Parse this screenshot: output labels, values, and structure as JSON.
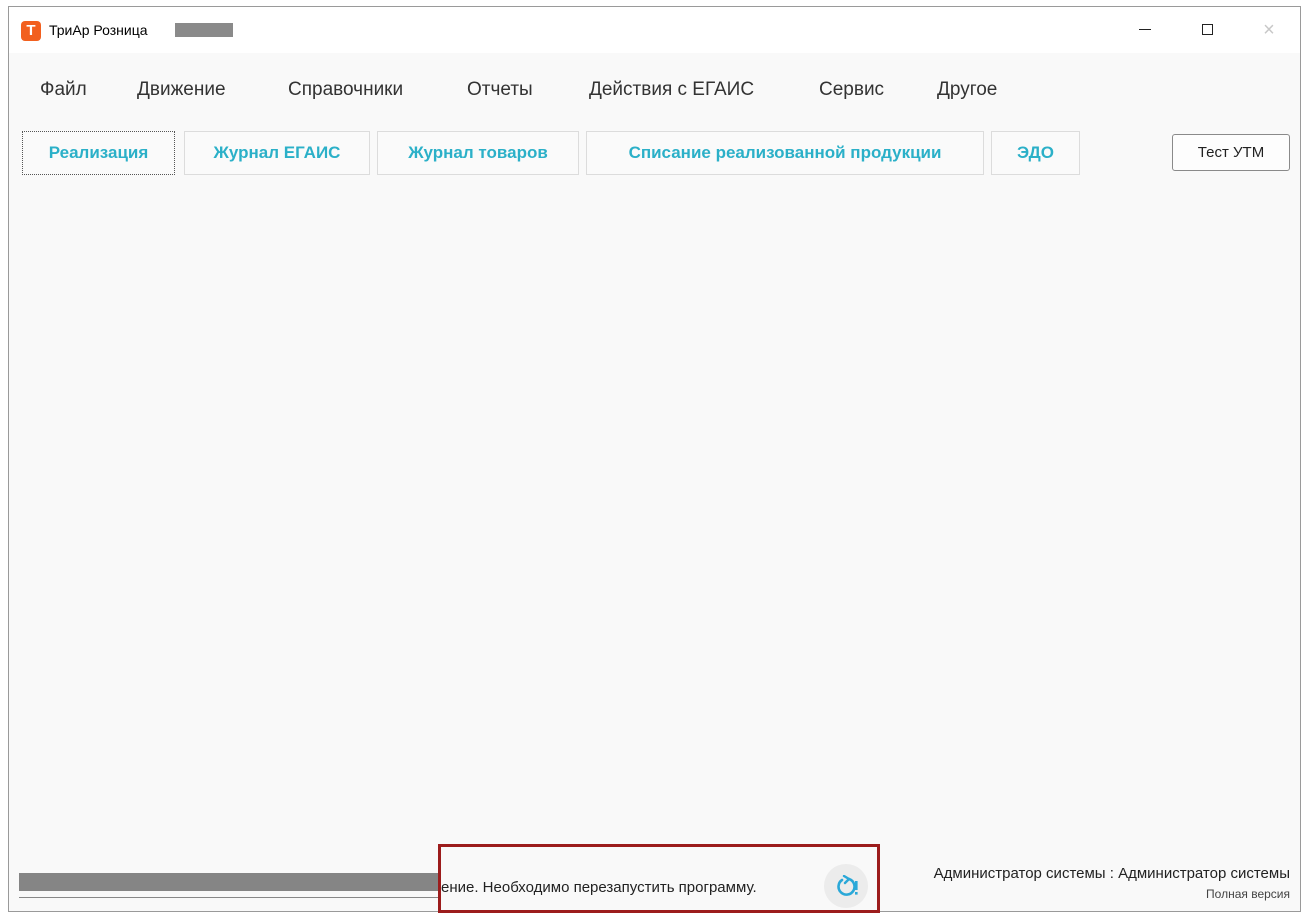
{
  "window": {
    "app_title": "ТриАр Розница",
    "app_icon_letter": "T",
    "controls": {
      "minimize": "minimize-icon",
      "maximize": "maximize-icon",
      "close": "×"
    }
  },
  "menu": {
    "items": [
      "Файл",
      "Движение",
      "Справочники",
      "Отчеты",
      "Действия с ЕГАИС",
      "Сервис",
      "Другое"
    ]
  },
  "tabs": {
    "items": [
      "Реализация",
      "Журнал ЕГАИС",
      "Журнал товаров",
      "Списание реализованной продукции",
      "ЭДО"
    ],
    "active": "Реализация"
  },
  "toolbar": {
    "test_utm_label": "Тест УТМ"
  },
  "status": {
    "notice": "ение. Необходимо перезапустить программу.",
    "restart_icon": "restart-icon",
    "user": "Администратор системы : Администратор системы",
    "version": "Полная версия"
  },
  "colors": {
    "accent": "#2bb0c8",
    "app_icon": "#f2601f",
    "notice_border": "#9c1c1c"
  }
}
